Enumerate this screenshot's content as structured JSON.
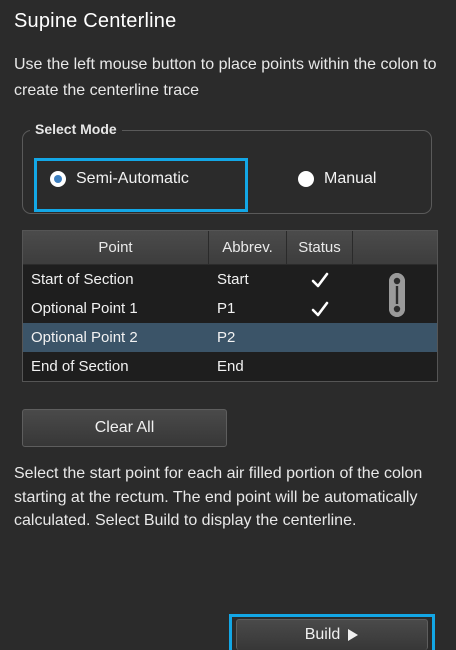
{
  "panel": {
    "title": "Supine Centerline",
    "instructions": "Use the left mouse button to place points within the colon to create the centerline trace"
  },
  "select_mode": {
    "legend": "Select Mode",
    "options": [
      {
        "label": "Semi-Automatic",
        "selected": true
      },
      {
        "label": "Manual",
        "selected": false
      }
    ]
  },
  "table": {
    "headers": [
      "Point",
      "Abbrev.",
      "Status",
      ""
    ],
    "rows": [
      {
        "point": "Start of Section",
        "abbrev": "Start",
        "status": "checked"
      },
      {
        "point": "Optional Point 1",
        "abbrev": "P1",
        "status": "checked"
      },
      {
        "point": "Optional Point 2",
        "abbrev": "P2",
        "status": "",
        "selected": true
      },
      {
        "point": "End of Section",
        "abbrev": "End",
        "status": ""
      }
    ]
  },
  "buttons": {
    "clear_all": "Clear All",
    "build": "Build"
  },
  "description": "Select the start point for each air filled portion of the colon starting at the rectum. The end point will be automatically calculated. Select Build to display the centerline.",
  "colors": {
    "highlight": "#13a7e6",
    "selected_row": "#3b5468",
    "background": "#2b2b2b"
  },
  "icons": [
    "radio-selected-icon",
    "radio-unselected-icon",
    "checkmark-icon",
    "scroll-handle-icon",
    "play-arrow-icon"
  ]
}
